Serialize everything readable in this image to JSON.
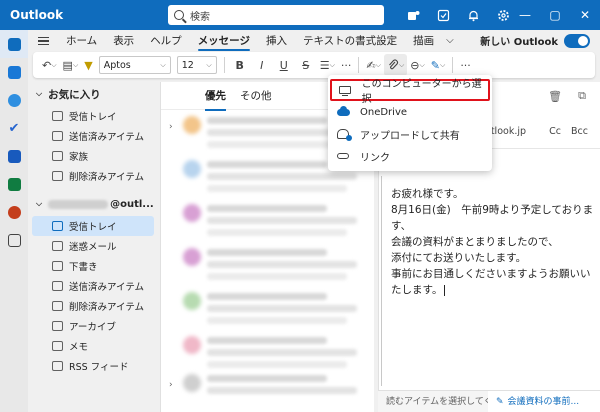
{
  "window": {
    "app_name": "Outlook",
    "search_placeholder": "検索",
    "title_icons": [
      "teams-icon",
      "note-icon",
      "bell-icon",
      "gear-icon"
    ],
    "controls": [
      "minimize-icon",
      "maximize-icon",
      "close-icon"
    ]
  },
  "tabs": {
    "items": [
      "ホーム",
      "表示",
      "ヘルプ",
      "メッセージ",
      "挿入",
      "テキストの書式設定",
      "描画"
    ],
    "active": "メッセージ",
    "new_outlook_label": "新しい Outlook",
    "new_outlook_on": true
  },
  "ribbon": {
    "font_name": "Aptos",
    "font_size": "12",
    "bold": "B",
    "italic": "I",
    "underline": "U",
    "strike": "S"
  },
  "folders": {
    "favorites_label": "お気に入り",
    "favorites": [
      "受信トレイ",
      "送信済みアイテム",
      "家族",
      "削除済みアイテム"
    ],
    "account_suffix": "@outl...",
    "account_folders": [
      "受信トレイ",
      "迷惑メール",
      "下書き",
      "送信済みアイテム",
      "削除済みアイテム",
      "アーカイブ",
      "メモ",
      "RSS フィード"
    ],
    "active_folder": "受信トレイ"
  },
  "message_list": {
    "tab_focused": "優先",
    "tab_other": "その他"
  },
  "compose": {
    "to_fragment": "outlook.jp",
    "cc": "Cc",
    "bcc": "Bcc",
    "body_lines": [
      "お疲れ様です。",
      "8月16日(金)　午前9時より予定しておりま",
      "す、",
      "会議の資料がまとまりましたので、",
      "添付にてお送りいたします。",
      "事前にお目通しくださいますようお願いい",
      "たします。"
    ]
  },
  "dropdown": {
    "items": [
      {
        "label": "このコンピューターから選択",
        "icon": "monitor-icon",
        "highlighted": true
      },
      {
        "label": "OneDrive",
        "icon": "onedrive-icon",
        "highlighted": false
      },
      {
        "label": "アップロードして共有",
        "icon": "cloud-upload-icon",
        "highlighted": false
      },
      {
        "label": "リンク",
        "icon": "link-icon",
        "highlighted": false
      }
    ],
    "highlight_color": "#e0121b"
  },
  "bottom_bar": {
    "left_label": "読むアイテムを選択してく...",
    "right_label": "会議資料の事前..."
  },
  "colors": {
    "accent": "#0f6cbd",
    "selection": "#cfe4fa"
  }
}
